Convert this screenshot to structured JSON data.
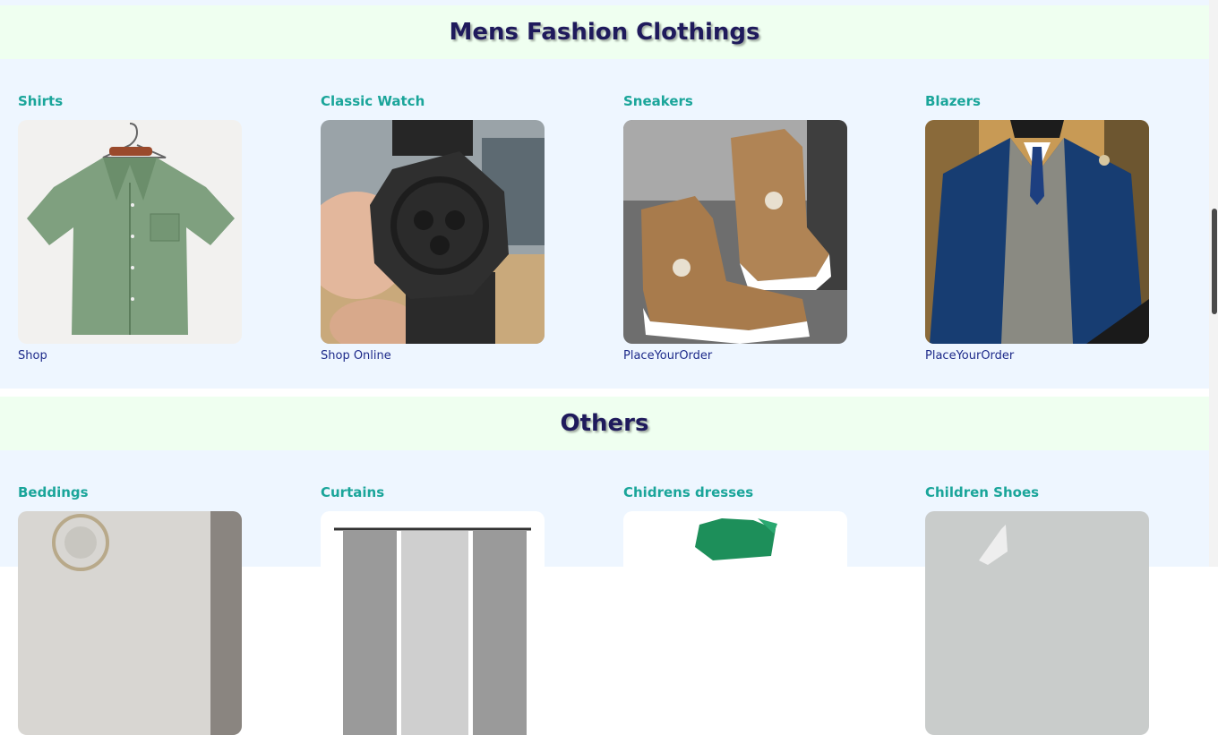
{
  "sections": [
    {
      "title": "Mens Fashion Clothings",
      "items": [
        {
          "title": "Shirts",
          "link": "Shop",
          "image_icon": "green-shirt-image"
        },
        {
          "title": "Classic Watch",
          "link": "Shop Online",
          "image_icon": "black-watch-image"
        },
        {
          "title": "Sneakers",
          "link": "PlaceYourOrder",
          "image_icon": "brown-sneakers-image"
        },
        {
          "title": "Blazers",
          "link": "PlaceYourOrder",
          "image_icon": "blue-blazer-image"
        }
      ]
    },
    {
      "title": "Others",
      "items": [
        {
          "title": "Beddings",
          "image_icon": "bedroom-image"
        },
        {
          "title": "Curtains",
          "image_icon": "curtains-image"
        },
        {
          "title": "Chidrens dresses",
          "image_icon": "green-dress-image"
        },
        {
          "title": "Children Shoes",
          "image_icon": "children-shoes-image"
        }
      ]
    }
  ],
  "colors": {
    "band_bg": "#effff0",
    "section_bg": "#eef6ff",
    "title_color": "#1f1a5c",
    "item_title_color": "#1aa59a",
    "link_color": "#1d2a8a"
  }
}
